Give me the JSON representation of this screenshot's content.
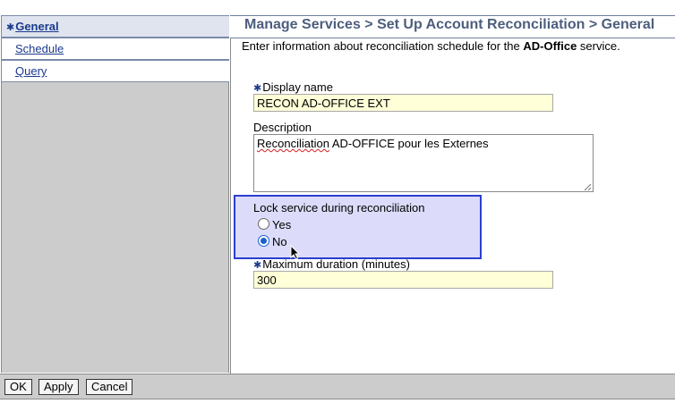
{
  "sidebar": {
    "items": [
      {
        "label": "General",
        "required": true,
        "active": true
      },
      {
        "label": "Schedule"
      },
      {
        "label": "Query"
      }
    ]
  },
  "header": {
    "title": "Manage Services > Set Up Account Reconciliation > General"
  },
  "intro": {
    "prefix": "Enter information about reconciliation schedule for the ",
    "service": "AD-Office",
    "suffix": " service."
  },
  "form": {
    "display_name": {
      "label": "Display name",
      "required": true,
      "value": "RECON AD-OFFICE EXT"
    },
    "description": {
      "label": "Description",
      "value_first_word": "Reconciliation",
      "value_rest": " AD-OFFICE pour les Externes"
    },
    "lock": {
      "label": "Lock service during reconciliation",
      "options": [
        "Yes",
        "No"
      ],
      "selected": "No"
    },
    "max_duration": {
      "label": "Maximum duration (minutes)",
      "required": true,
      "value": "300"
    }
  },
  "footer": {
    "ok_label": "OK",
    "apply_label": "Apply",
    "cancel_label": "Cancel"
  },
  "colors": {
    "highlight_border": "#2a3fd0",
    "highlight_fill": "#dcdcfa",
    "input_fill": "#ffffd8",
    "link": "#1a3a8c"
  }
}
